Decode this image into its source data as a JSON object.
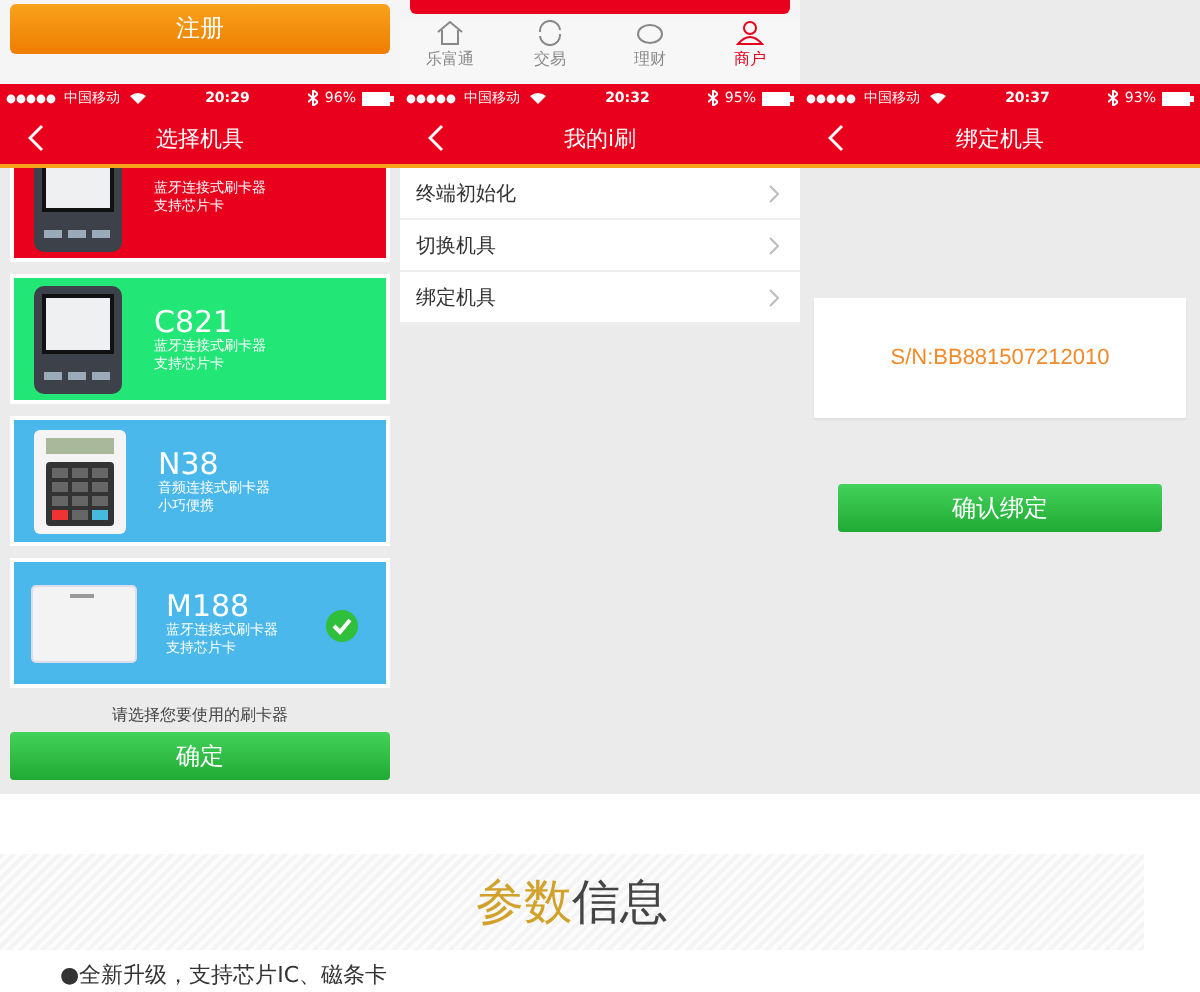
{
  "phones": [
    {
      "kind": "select",
      "top": {
        "button": "注册"
      },
      "status_bar": {
        "carrier": "中国移动",
        "time": "20:29",
        "battery": "96%"
      },
      "title": "选择机具",
      "readers": [
        {
          "lines": [
            "蓝牙连接式刷卡器",
            "支持芯片卡"
          ],
          "color": "#e8001c",
          "kind": "terminal",
          "selected": false
        },
        {
          "model": "C821",
          "lines": [
            "蓝牙连接式刷卡器",
            "支持芯片卡"
          ],
          "color": "#22e676",
          "kind": "terminal",
          "selected": false
        },
        {
          "model": "N38",
          "lines": [
            "音频连接式刷卡器",
            "小巧便携"
          ],
          "color": "#4ab8ea",
          "kind": "keypad",
          "selected": false
        },
        {
          "model": "M188",
          "lines": [
            "蓝牙连接式刷卡器",
            "支持芯片卡"
          ],
          "color": "#4ab8ea",
          "kind": "box",
          "selected": true
        }
      ],
      "hint": "请选择您要使用的刷卡器",
      "button": "确定"
    },
    {
      "kind": "menu",
      "top": {
        "tabs": [
          {
            "label": "乐富通",
            "selected": false
          },
          {
            "label": "交易",
            "selected": false
          },
          {
            "label": "理财",
            "selected": false
          },
          {
            "label": "商户",
            "selected": true
          }
        ]
      },
      "status_bar": {
        "carrier": "中国移动",
        "time": "20:32",
        "battery": "95%"
      },
      "title": "我的i刷",
      "items": [
        "终端初始化",
        "切换机具",
        "绑定机具"
      ]
    },
    {
      "kind": "bind",
      "status_bar": {
        "carrier": "中国移动",
        "time": "20:37",
        "battery": "93%"
      },
      "title": "绑定机具",
      "serial": "S/N:BB881507212010",
      "button": "确认绑定"
    }
  ],
  "section": {
    "title_accent": "参数",
    "title_rest": "信息",
    "bullet": "●全新升级，支持芯片IC、磁条卡"
  }
}
